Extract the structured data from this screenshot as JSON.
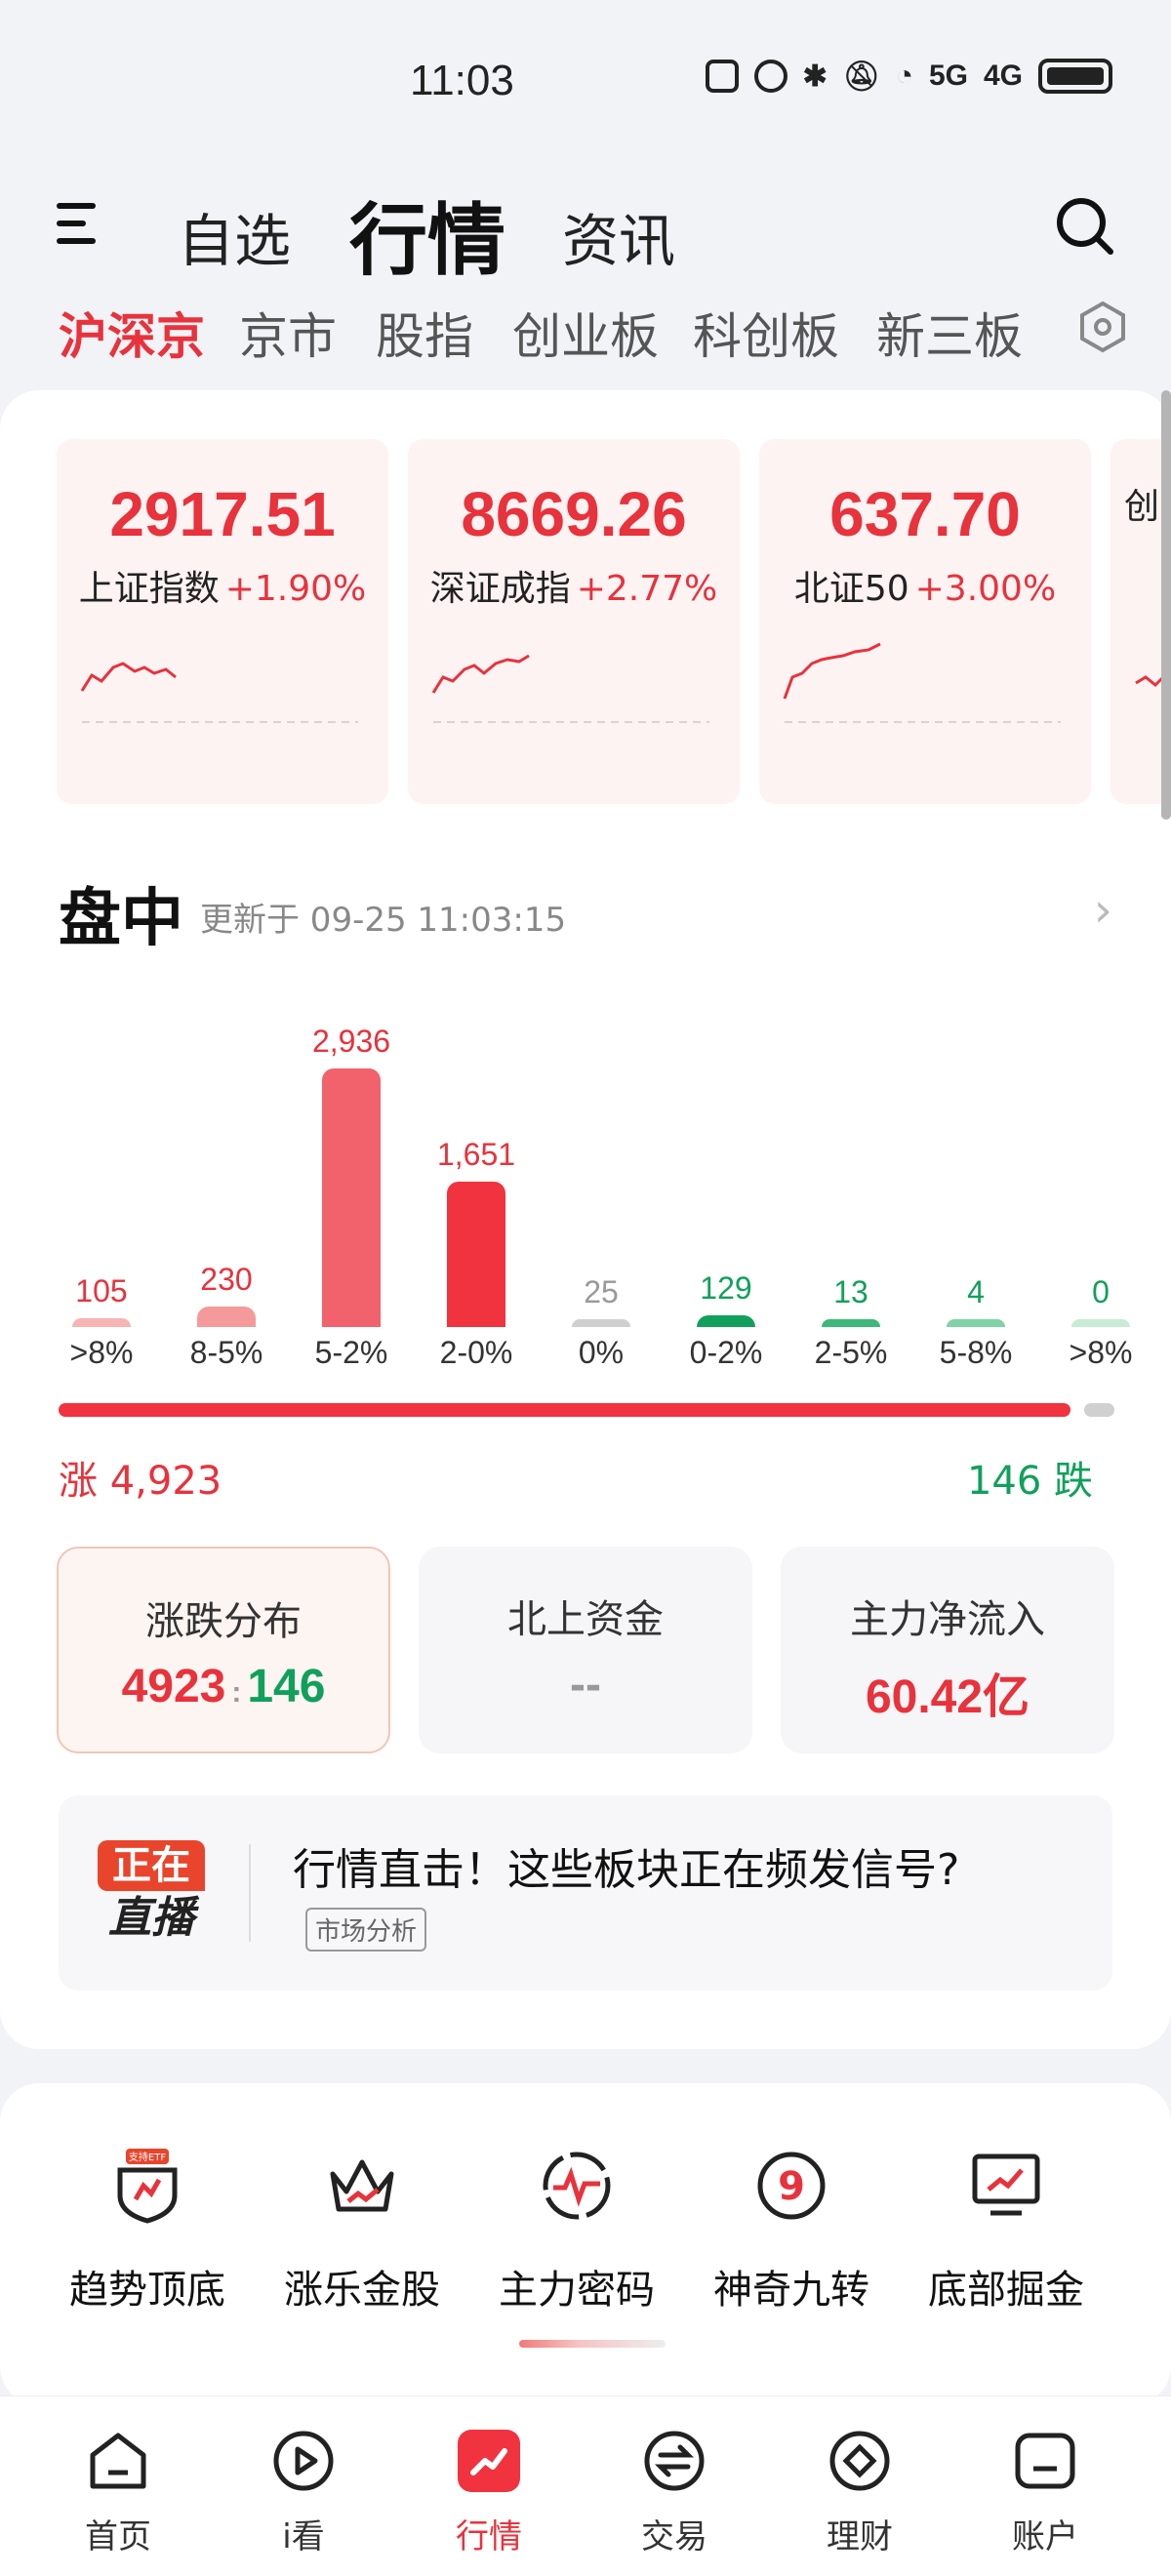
{
  "status_bar": {
    "time": "11:03",
    "signal_5g": "5G",
    "signal_4g": "4G"
  },
  "header": {
    "tabs": [
      {
        "label": "自选",
        "active": false
      },
      {
        "label": "行情",
        "active": true
      },
      {
        "label": "资讯",
        "active": false
      }
    ]
  },
  "market_tabs": [
    {
      "label": "沪深京",
      "active": true
    },
    {
      "label": "京市",
      "active": false
    },
    {
      "label": "股指",
      "active": false
    },
    {
      "label": "创业板",
      "active": false
    },
    {
      "label": "科创板",
      "active": false
    },
    {
      "label": "新三板",
      "active": false
    }
  ],
  "indices": [
    {
      "value": "2917.51",
      "name": "上证指数",
      "change": "+1.90%"
    },
    {
      "value": "8669.26",
      "name": "深证成指",
      "change": "+2.77%"
    },
    {
      "value": "637.70",
      "name": "北证50",
      "change": "+3.00%"
    },
    {
      "value": "",
      "name": "创",
      "change": ""
    }
  ],
  "section": {
    "title": "盘中",
    "updated": "更新于 09-25 11:03:15"
  },
  "chart_data": {
    "type": "bar",
    "categories": [
      ">8%",
      "8-5%",
      "5-2%",
      "2-0%",
      "0%",
      "0-2%",
      "2-5%",
      "5-8%",
      ">8%"
    ],
    "values": [
      105,
      230,
      2936,
      1651,
      25,
      129,
      13,
      4,
      0
    ],
    "value_labels": [
      "105",
      "230",
      "2,936",
      "1,651",
      "25",
      "129",
      "13",
      "4",
      "0"
    ],
    "colors": [
      "#f7b4b4",
      "#f59a9a",
      "#f2626c",
      "#f0333f",
      "#cfcfcf",
      "#11a05c",
      "#3db87a",
      "#7fd3a6",
      "#c8ebd6"
    ],
    "label_colors": [
      "#e8323c",
      "#e8323c",
      "#e8323c",
      "#e8323c",
      "#999999",
      "#11a05c",
      "#11a05c",
      "#11a05c",
      "#11a05c"
    ],
    "ylim": [
      0,
      2936
    ]
  },
  "breadth": {
    "up_label": "涨 4,923",
    "down_label": "146 跌",
    "up": 4923,
    "down": 146
  },
  "stats": [
    {
      "title": "涨跌分布",
      "value_up": "4923",
      "sep": ":",
      "value_down": "146",
      "active": true
    },
    {
      "title": "北上资金",
      "value": "--",
      "active": false
    },
    {
      "title": "主力净流入",
      "value": "60.42亿",
      "active": false
    }
  ],
  "live_banner": {
    "badge_top": "正在",
    "badge_bottom": "直播",
    "title": "行情直击！这些板块正在频发信号?",
    "tag": "市场分析"
  },
  "tools": [
    {
      "label": "趋势顶底",
      "badge": "支持ETF",
      "icon": "trend-shield-icon"
    },
    {
      "label": "涨乐金股",
      "icon": "crown-icon"
    },
    {
      "label": "主力密码",
      "icon": "pulse-circle-icon"
    },
    {
      "label": "神奇九转",
      "icon": "nine-circle-icon"
    },
    {
      "label": "底部掘金",
      "icon": "monitor-chart-icon"
    }
  ],
  "tabbar": [
    {
      "label": "首页",
      "icon": "home-icon",
      "active": false
    },
    {
      "label": "i看",
      "icon": "play-icon",
      "active": false
    },
    {
      "label": "行情",
      "icon": "market-icon",
      "active": true
    },
    {
      "label": "交易",
      "icon": "exchange-icon",
      "active": false
    },
    {
      "label": "理财",
      "icon": "diamond-icon",
      "active": false
    },
    {
      "label": "账户",
      "icon": "account-icon",
      "active": false
    }
  ],
  "colors": {
    "accent_red": "#e8323c",
    "accent_green": "#11a05c"
  }
}
